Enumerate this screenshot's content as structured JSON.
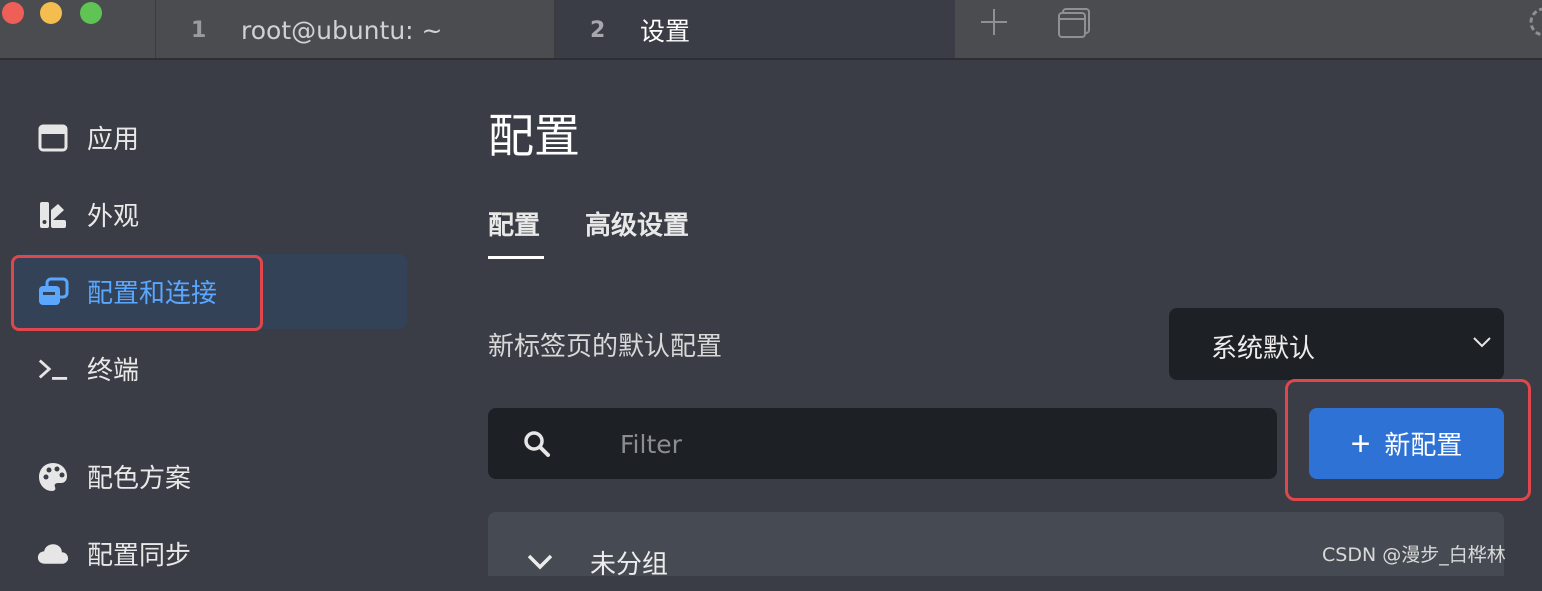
{
  "tabs": [
    {
      "number": "1",
      "title": "root@ubuntu: ~"
    },
    {
      "number": "2",
      "title": "设置"
    }
  ],
  "tabbar_icons": [
    "plus-icon",
    "window-icon",
    "gear-icon"
  ],
  "sidebar": {
    "items": [
      {
        "label": "应用",
        "icon": "window-icon"
      },
      {
        "label": "外观",
        "icon": "appearance-icon"
      },
      {
        "label": "配置和连接",
        "icon": "profiles-icon",
        "active": true
      },
      {
        "label": "终端",
        "icon": "terminal-icon"
      },
      {
        "label": "配色方案",
        "icon": "palette-icon"
      },
      {
        "label": "配置同步",
        "icon": "cloud-icon"
      }
    ]
  },
  "main": {
    "title": "配置",
    "subtabs": [
      {
        "label": "配置",
        "active": true
      },
      {
        "label": "高级设置"
      }
    ],
    "default_profile": {
      "label": "新标签页的默认配置",
      "value": "系统默认"
    },
    "filter": {
      "placeholder": "Filter",
      "value": ""
    },
    "new_button": {
      "plus": "+",
      "label": "新配置"
    },
    "group": {
      "label": "未分组"
    }
  },
  "watermark": "CSDN @漫步_白桦林",
  "colors": {
    "accent": "#2f72d6",
    "active_text": "#5aa7ff",
    "highlight_border": "#e0474c",
    "background": "#3a3d45"
  }
}
